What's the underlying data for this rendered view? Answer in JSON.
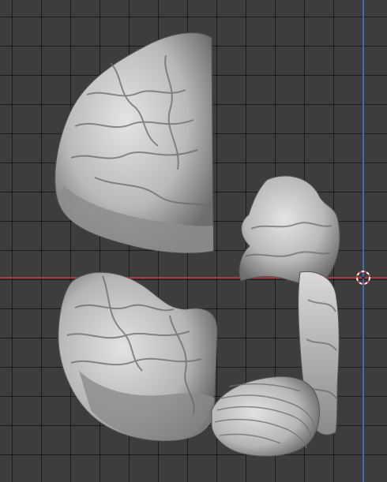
{
  "viewport": {
    "background": "#3d3d3d",
    "grid_color": "#1f1f1f",
    "x_axis_color": "#a83a3a",
    "y_axis_color": "#3b6fb0",
    "cursor_colors": [
      "#d94a4a",
      "#ffffff"
    ]
  },
  "scene": {
    "objects": [
      {
        "name": "brain-hemisphere-top"
      },
      {
        "name": "brain-hemisphere-bottom"
      },
      {
        "name": "brainstem-midsection"
      },
      {
        "name": "cerebellum"
      }
    ],
    "material_color": "#c9c9c9"
  },
  "icons": {
    "cursor": "3d-cursor-icon"
  }
}
